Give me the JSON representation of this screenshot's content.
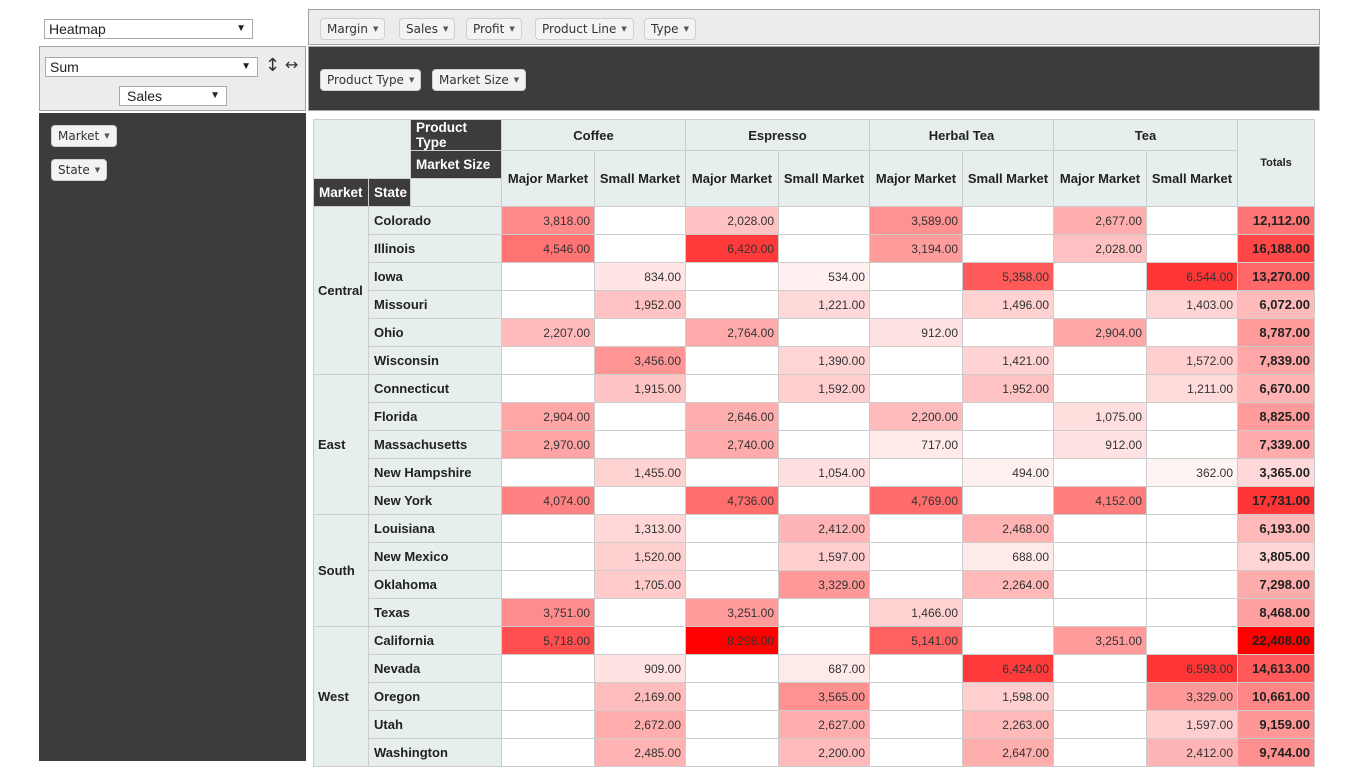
{
  "renderer": {
    "selected": "Heatmap"
  },
  "aggregator": {
    "selected": "Sum",
    "value_selected": "Sales",
    "sort_icon": "vertical-arrows-icon",
    "flip_icon": "horizontal-arrows-icon"
  },
  "unused_attrs": [
    "Margin",
    "Sales",
    "Profit",
    "Product Line",
    "Type"
  ],
  "col_attrs": [
    "Product Type",
    "Market Size"
  ],
  "row_attrs": [
    "Market",
    "State"
  ],
  "table": {
    "col_attr_labels": [
      "Product Type",
      "Market Size"
    ],
    "row_attr_labels": [
      "Market",
      "State"
    ],
    "product_types": [
      "Coffee",
      "Espresso",
      "Herbal Tea",
      "Tea"
    ],
    "market_sizes": [
      "Major Market",
      "Small Market",
      "Major Market",
      "Small Market",
      "Major Market",
      "Small Market",
      "Major Market",
      "Small Market"
    ],
    "totals_label": "Totals",
    "heat_color": "#ff0000",
    "markets": [
      {
        "name": "Central",
        "rows": [
          {
            "state": "Colorado",
            "values": [
              3818,
              null,
              2028,
              null,
              3589,
              null,
              2677,
              null
            ],
            "total": 12112
          },
          {
            "state": "Illinois",
            "values": [
              4546,
              null,
              6420,
              null,
              3194,
              null,
              2028,
              null
            ],
            "total": 16188
          },
          {
            "state": "Iowa",
            "values": [
              null,
              834,
              null,
              534,
              null,
              5358,
              null,
              6544
            ],
            "total": 13270
          },
          {
            "state": "Missouri",
            "values": [
              null,
              1952,
              null,
              1221,
              null,
              1496,
              null,
              1403
            ],
            "total": 6072
          },
          {
            "state": "Ohio",
            "values": [
              2207,
              null,
              2764,
              null,
              912,
              null,
              2904,
              null
            ],
            "total": 8787
          },
          {
            "state": "Wisconsin",
            "values": [
              null,
              3456,
              null,
              1390,
              null,
              1421,
              null,
              1572
            ],
            "total": 7839
          }
        ]
      },
      {
        "name": "East",
        "rows": [
          {
            "state": "Connecticut",
            "values": [
              null,
              1915,
              null,
              1592,
              null,
              1952,
              null,
              1211
            ],
            "total": 6670
          },
          {
            "state": "Florida",
            "values": [
              2904,
              null,
              2646,
              null,
              2200,
              null,
              1075,
              null
            ],
            "total": 8825
          },
          {
            "state": "Massachusetts",
            "values": [
              2970,
              null,
              2740,
              null,
              717,
              null,
              912,
              null
            ],
            "total": 7339
          },
          {
            "state": "New Hampshire",
            "values": [
              null,
              1455,
              null,
              1054,
              null,
              494,
              null,
              362
            ],
            "total": 3365
          },
          {
            "state": "New York",
            "values": [
              4074,
              null,
              4736,
              null,
              4769,
              null,
              4152,
              null
            ],
            "total": 17731
          }
        ]
      },
      {
        "name": "South",
        "rows": [
          {
            "state": "Louisiana",
            "values": [
              null,
              1313,
              null,
              2412,
              null,
              2468,
              null,
              null
            ],
            "total": 6193
          },
          {
            "state": "New Mexico",
            "values": [
              null,
              1520,
              null,
              1597,
              null,
              688,
              null,
              null
            ],
            "total": 3805
          },
          {
            "state": "Oklahoma",
            "values": [
              null,
              1705,
              null,
              3329,
              null,
              2264,
              null,
              null
            ],
            "total": 7298
          },
          {
            "state": "Texas",
            "values": [
              3751,
              null,
              3251,
              null,
              1466,
              null,
              null,
              null
            ],
            "total": 8468
          }
        ]
      },
      {
        "name": "West",
        "rows": [
          {
            "state": "California",
            "values": [
              5718,
              null,
              8298,
              null,
              5141,
              null,
              3251,
              null
            ],
            "total": 22408
          },
          {
            "state": "Nevada",
            "values": [
              null,
              909,
              null,
              687,
              null,
              6424,
              null,
              6593
            ],
            "total": 14613
          },
          {
            "state": "Oregon",
            "values": [
              null,
              2169,
              null,
              3565,
              null,
              1598,
              null,
              3329
            ],
            "total": 10661
          },
          {
            "state": "Utah",
            "values": [
              null,
              2672,
              null,
              2627,
              null,
              2263,
              null,
              1597
            ],
            "total": 9159
          },
          {
            "state": "Washington",
            "values": [
              null,
              2485,
              null,
              2200,
              null,
              2647,
              null,
              2412
            ],
            "total": 9744
          }
        ]
      }
    ]
  }
}
